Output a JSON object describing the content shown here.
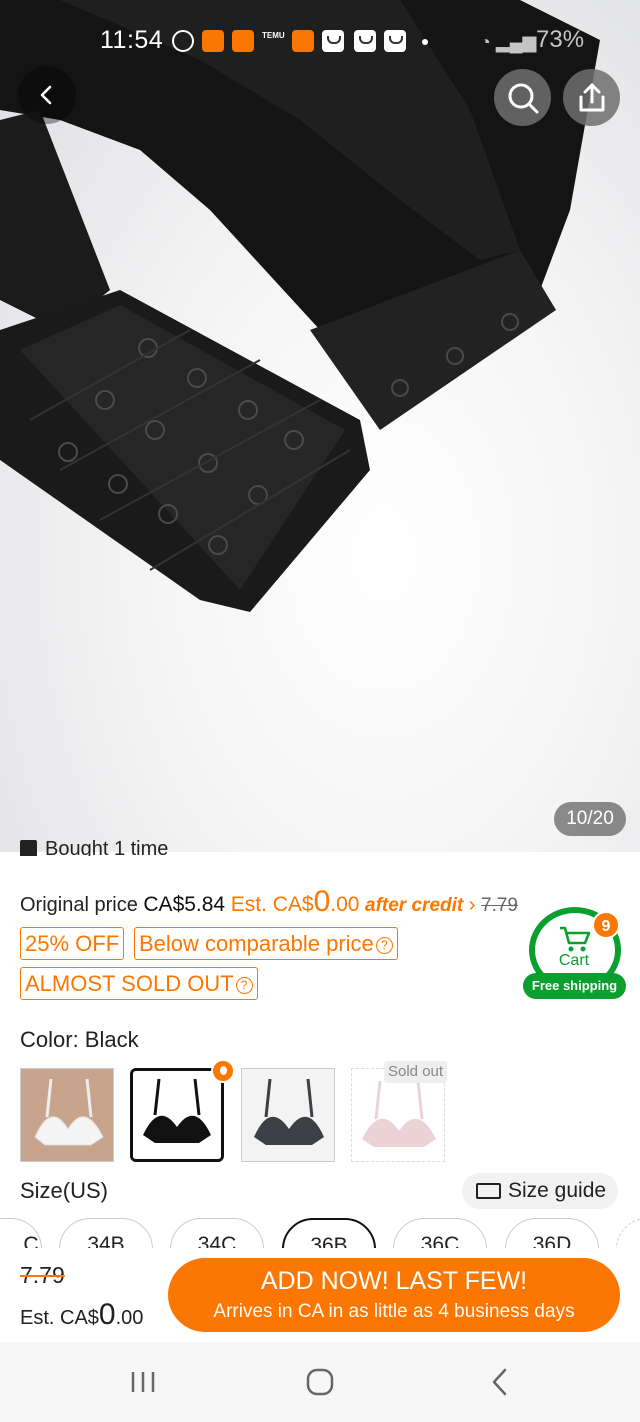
{
  "status_bar": {
    "time": "11:54",
    "temu_small": "TEMU",
    "battery": "73%",
    "icons": [
      "whatsapp-icon",
      "temu-icon",
      "temu-icon",
      "temu-icon",
      "temu-icon",
      "shopping-bag-icon",
      "shopping-bag-icon",
      "shopping-bag-icon",
      "notification-dot-icon",
      "battery-saver-icon",
      "wifi-icon",
      "signal-icon",
      "battery-icon"
    ]
  },
  "gallery": {
    "counter": "10/20"
  },
  "purchase_note": "Bought 1 time",
  "pricing": {
    "original_label": "Original price",
    "original_value": "CA$5.84",
    "est_prefix": "Est. CA$",
    "est_big": "0",
    "est_rest": ".00",
    "after_credit": "after credit",
    "strike": "7.79"
  },
  "tags": {
    "discount": "25% OFF",
    "comparable": "Below comparable price",
    "sold_out_soon": "ALMOST SOLD OUT"
  },
  "cart": {
    "label": "Cart",
    "count": "9",
    "free_shipping": "Free shipping"
  },
  "color": {
    "label": "Color: Black",
    "sold_out": "Sold out",
    "swatches": [
      "White",
      "Black",
      "Grey",
      "Pink"
    ]
  },
  "size": {
    "label": "Size(US)",
    "guide": "Size guide",
    "options": [
      "C",
      "34B",
      "34C",
      "36B",
      "36C",
      "36D"
    ]
  },
  "bottom_bar": {
    "strike": "7.79",
    "est_prefix": "Est. CA$",
    "est_big": "0",
    "est_rest": ".00",
    "cta_main": "ADD NOW! LAST FEW!",
    "cta_sub": "Arrives in CA in as little as 4 business days"
  },
  "colors": {
    "accent": "#fb7701",
    "cart_green": "#0a9f2e"
  }
}
